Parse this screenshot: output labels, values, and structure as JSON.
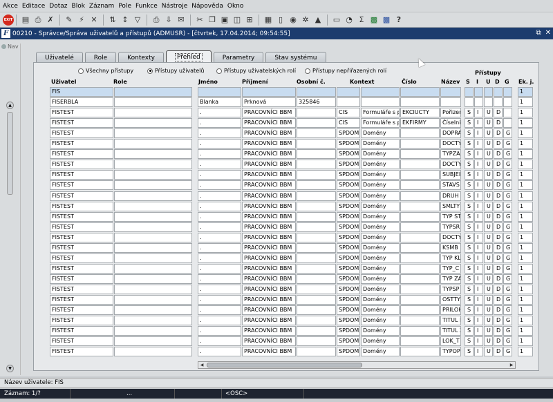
{
  "menubar": [
    "Akce",
    "Editace",
    "Dotaz",
    "Blok",
    "Záznam",
    "Pole",
    "Funkce",
    "Nástroje",
    "Nápověda",
    "Okno"
  ],
  "toolbar": {
    "exit_label": "EXIT",
    "sigma": "Σ",
    "help": "?"
  },
  "window": {
    "title": "00210 - Správce/Správa uživatelů a přístupů (ADMUSR) - [čtvrtek, 17.04.2014; 09:54:55]",
    "logo": "F",
    "controls": [
      "⧉",
      "✕"
    ]
  },
  "nav": {
    "label": "Nav"
  },
  "tabs": [
    "Uživatelé",
    "Role",
    "Kontexty",
    "Přehled",
    "Parametry",
    "Stav systému"
  ],
  "radios": [
    {
      "label": "Všechny přístupy",
      "on": false
    },
    {
      "label": "Přístupy uživatelů",
      "on": true
    },
    {
      "label": "Přístupy uživatelských rolí",
      "on": false
    },
    {
      "label": "Přístupy nepřiřazených rolí",
      "on": false
    }
  ],
  "headers": {
    "uzivatel": "Uživatel",
    "role": "Role",
    "jmeno": "Jméno",
    "prijmeni": "Příjmení",
    "osobni": "Osobní č.",
    "kontext": "Kontext",
    "cislo": "Číslo",
    "nazev": "Název",
    "pristupy": "Přístupy",
    "s": "S",
    "i": "I",
    "u": "U",
    "d": "D",
    "g": "G",
    "ekj": "Ek. j."
  },
  "rows": [
    {
      "uzivatel": "FIS",
      "role": "",
      "jmeno": "",
      "prijmeni": "",
      "osobni": "",
      "ctx": "",
      "ctxname": "",
      "cislo": "",
      "nazev": "",
      "s": "",
      "i": "",
      "u": "",
      "d": "",
      "g": "",
      "ekj": "1"
    },
    {
      "uzivatel": "FISERBLA",
      "role": "",
      "jmeno": "Blanka",
      "prijmeni": "Prknová",
      "osobni": "325846",
      "ctx": "",
      "ctxname": "",
      "cislo": "",
      "nazev": "",
      "s": "",
      "i": "",
      "u": "",
      "d": "",
      "g": "",
      "ekj": "1"
    },
    {
      "uzivatel": "FISTEST",
      "role": "",
      "jmeno": ".",
      "prijmeni": "PRACOVNÍCI BBM",
      "osobni": "",
      "ctx": "CIS",
      "ctxname": "Formuláře s pi",
      "cislo": "EKCIUCTY",
      "nazev": "Pořizen",
      "s": "S",
      "i": "I",
      "u": "U",
      "d": "D",
      "g": "",
      "ekj": "1"
    },
    {
      "uzivatel": "FISTEST",
      "role": "",
      "jmeno": ".",
      "prijmeni": "PRACOVNÍCI BBM",
      "osobni": "",
      "ctx": "CIS",
      "ctxname": "Formuláře s pi",
      "cislo": "EKFIRMY",
      "nazev": "Číselník",
      "s": "S",
      "i": "I",
      "u": "U",
      "d": "D",
      "g": "",
      "ekj": "1"
    },
    {
      "uzivatel": "FISTEST",
      "role": "",
      "jmeno": ".",
      "prijmeni": "PRACOVNÍCI BBM",
      "osobni": "",
      "ctx": "SPDOM",
      "ctxname": "Domény",
      "cislo": "",
      "nazev": "DOPRA",
      "s": "S",
      "i": "I",
      "u": "U",
      "d": "D",
      "g": "G",
      "ekj": "1"
    },
    {
      "uzivatel": "FISTEST",
      "role": "",
      "jmeno": ".",
      "prijmeni": "PRACOVNÍCI BBM",
      "osobni": "",
      "ctx": "SPDOM",
      "ctxname": "Domény",
      "cislo": "",
      "nazev": "DOCTY",
      "s": "S",
      "i": "I",
      "u": "U",
      "d": "D",
      "g": "G",
      "ekj": "1"
    },
    {
      "uzivatel": "FISTEST",
      "role": "",
      "jmeno": ".",
      "prijmeni": "PRACOVNÍCI BBM",
      "osobni": "",
      "ctx": "SPDOM",
      "ctxname": "Domény",
      "cislo": "",
      "nazev": "TYPZA",
      "s": "S",
      "i": "I",
      "u": "U",
      "d": "D",
      "g": "G",
      "ekj": "1"
    },
    {
      "uzivatel": "FISTEST",
      "role": "",
      "jmeno": ".",
      "prijmeni": "PRACOVNÍCI BBM",
      "osobni": "",
      "ctx": "SPDOM",
      "ctxname": "Domény",
      "cislo": "",
      "nazev": "DOCTY",
      "s": "S",
      "i": "I",
      "u": "U",
      "d": "D",
      "g": "G",
      "ekj": "1"
    },
    {
      "uzivatel": "FISTEST",
      "role": "",
      "jmeno": ".",
      "prijmeni": "PRACOVNÍCI BBM",
      "osobni": "",
      "ctx": "SPDOM",
      "ctxname": "Domény",
      "cislo": "",
      "nazev": "SUBJEI",
      "s": "S",
      "i": "I",
      "u": "U",
      "d": "D",
      "g": "G",
      "ekj": "1"
    },
    {
      "uzivatel": "FISTEST",
      "role": "",
      "jmeno": ".",
      "prijmeni": "PRACOVNÍCI BBM",
      "osobni": "",
      "ctx": "SPDOM",
      "ctxname": "Domény",
      "cislo": "",
      "nazev": "STAVS",
      "s": "S",
      "i": "I",
      "u": "U",
      "d": "D",
      "g": "G",
      "ekj": "1"
    },
    {
      "uzivatel": "FISTEST",
      "role": "",
      "jmeno": ".",
      "prijmeni": "PRACOVNÍCI BBM",
      "osobni": "",
      "ctx": "SPDOM",
      "ctxname": "Domény",
      "cislo": "",
      "nazev": "DRUH Z",
      "s": "S",
      "i": "I",
      "u": "U",
      "d": "D",
      "g": "G",
      "ekj": "1"
    },
    {
      "uzivatel": "FISTEST",
      "role": "",
      "jmeno": ".",
      "prijmeni": "PRACOVNÍCI BBM",
      "osobni": "",
      "ctx": "SPDOM",
      "ctxname": "Domény",
      "cislo": "",
      "nazev": "SMLTY",
      "s": "S",
      "i": "I",
      "u": "U",
      "d": "D",
      "g": "G",
      "ekj": "1"
    },
    {
      "uzivatel": "FISTEST",
      "role": "",
      "jmeno": ".",
      "prijmeni": "PRACOVNÍCI BBM",
      "osobni": "",
      "ctx": "SPDOM",
      "ctxname": "Domény",
      "cislo": "",
      "nazev": "TYP ST",
      "s": "S",
      "i": "I",
      "u": "U",
      "d": "D",
      "g": "G",
      "ekj": "1"
    },
    {
      "uzivatel": "FISTEST",
      "role": "",
      "jmeno": ".",
      "prijmeni": "PRACOVNÍCI BBM",
      "osobni": "",
      "ctx": "SPDOM",
      "ctxname": "Domény",
      "cislo": "",
      "nazev": "TYPSR",
      "s": "S",
      "i": "I",
      "u": "U",
      "d": "D",
      "g": "G",
      "ekj": "1"
    },
    {
      "uzivatel": "FISTEST",
      "role": "",
      "jmeno": ".",
      "prijmeni": "PRACOVNÍCI BBM",
      "osobni": "",
      "ctx": "SPDOM",
      "ctxname": "Domény",
      "cislo": "",
      "nazev": "DOCTY",
      "s": "S",
      "i": "I",
      "u": "U",
      "d": "D",
      "g": "G",
      "ekj": "1"
    },
    {
      "uzivatel": "FISTEST",
      "role": "",
      "jmeno": ".",
      "prijmeni": "PRACOVNÍCI BBM",
      "osobni": "",
      "ctx": "SPDOM",
      "ctxname": "Domény",
      "cislo": "",
      "nazev": "KSMB",
      "s": "S",
      "i": "I",
      "u": "U",
      "d": "D",
      "g": "G",
      "ekj": "1"
    },
    {
      "uzivatel": "FISTEST",
      "role": "",
      "jmeno": ".",
      "prijmeni": "PRACOVNÍCI BBM",
      "osobni": "",
      "ctx": "SPDOM",
      "ctxname": "Domény",
      "cislo": "",
      "nazev": "TYP KL",
      "s": "S",
      "i": "I",
      "u": "U",
      "d": "D",
      "g": "G",
      "ekj": "1"
    },
    {
      "uzivatel": "FISTEST",
      "role": "",
      "jmeno": ".",
      "prijmeni": "PRACOVNÍCI BBM",
      "osobni": "",
      "ctx": "SPDOM",
      "ctxname": "Domény",
      "cislo": "",
      "nazev": "TYP_C",
      "s": "S",
      "i": "I",
      "u": "U",
      "d": "D",
      "g": "G",
      "ekj": "1"
    },
    {
      "uzivatel": "FISTEST",
      "role": "",
      "jmeno": ".",
      "prijmeni": "PRACOVNÍCI BBM",
      "osobni": "",
      "ctx": "SPDOM",
      "ctxname": "Domény",
      "cislo": "",
      "nazev": "TYP ZA",
      "s": "S",
      "i": "I",
      "u": "U",
      "d": "D",
      "g": "G",
      "ekj": "1"
    },
    {
      "uzivatel": "FISTEST",
      "role": "",
      "jmeno": ".",
      "prijmeni": "PRACOVNÍCI BBM",
      "osobni": "",
      "ctx": "SPDOM",
      "ctxname": "Domény",
      "cislo": "",
      "nazev": "TYPSP",
      "s": "S",
      "i": "I",
      "u": "U",
      "d": "D",
      "g": "G",
      "ekj": "1"
    },
    {
      "uzivatel": "FISTEST",
      "role": "",
      "jmeno": ".",
      "prijmeni": "PRACOVNÍCI BBM",
      "osobni": "",
      "ctx": "SPDOM",
      "ctxname": "Domény",
      "cislo": "",
      "nazev": "OSTTY",
      "s": "S",
      "i": "I",
      "u": "U",
      "d": "D",
      "g": "G",
      "ekj": "1"
    },
    {
      "uzivatel": "FISTEST",
      "role": "",
      "jmeno": ".",
      "prijmeni": "PRACOVNÍCI BBM",
      "osobni": "",
      "ctx": "SPDOM",
      "ctxname": "Domény",
      "cislo": "",
      "nazev": "PRILOH",
      "s": "S",
      "i": "I",
      "u": "U",
      "d": "D",
      "g": "G",
      "ekj": "1"
    },
    {
      "uzivatel": "FISTEST",
      "role": "",
      "jmeno": ".",
      "prijmeni": "PRACOVNÍCI BBM",
      "osobni": "",
      "ctx": "SPDOM",
      "ctxname": "Domény",
      "cislo": "",
      "nazev": "TITUL P",
      "s": "S",
      "i": "I",
      "u": "U",
      "d": "D",
      "g": "G",
      "ekj": "1"
    },
    {
      "uzivatel": "FISTEST",
      "role": "",
      "jmeno": ".",
      "prijmeni": "PRACOVNÍCI BBM",
      "osobni": "",
      "ctx": "SPDOM",
      "ctxname": "Domény",
      "cislo": "",
      "nazev": "TITUL Z",
      "s": "S",
      "i": "I",
      "u": "U",
      "d": "D",
      "g": "G",
      "ekj": "1"
    },
    {
      "uzivatel": "FISTEST",
      "role": "",
      "jmeno": ".",
      "prijmeni": "PRACOVNÍCI BBM",
      "osobni": "",
      "ctx": "SPDOM",
      "ctxname": "Domény",
      "cislo": "",
      "nazev": "LOK_T",
      "s": "S",
      "i": "I",
      "u": "U",
      "d": "D",
      "g": "G",
      "ekj": "1"
    },
    {
      "uzivatel": "FISTEST",
      "role": "",
      "jmeno": ".",
      "prijmeni": "PRACOVNÍCI BBM",
      "osobni": "",
      "ctx": "SPDOM",
      "ctxname": "Domény",
      "cislo": "",
      "nazev": "TYPOP",
      "s": "S",
      "i": "I",
      "u": "U",
      "d": "D",
      "g": "G",
      "ekj": "1"
    }
  ],
  "status": {
    "field": "Název uživatele: FIS",
    "record": "Záznam: 1/?",
    "dots": "...",
    "osc": "<OSC>"
  }
}
